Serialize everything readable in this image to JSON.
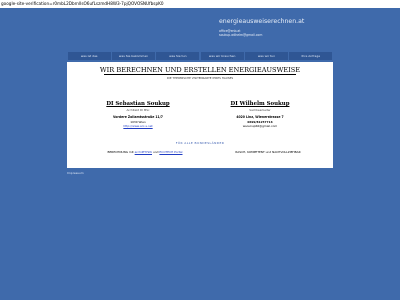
{
  "top_strip": {
    "text": "google-site-verification=r0mbL2DbrnlIsO6ufLszmdH8W3-7pjQOVOSNUfbspK0"
  },
  "banner": {
    "site_title": "energieausweiserechnen.at",
    "contact_line_1": "office@enb.at",
    "contact_line_2": "soukup.wilhelm@gmail.com"
  },
  "nav": {
    "items": [
      "was ist das",
      "was Sie bekommen",
      "was Sie tun",
      "was wir brauchen",
      "was wir tun",
      "Ihre Anfrage"
    ]
  },
  "main": {
    "title": "WIR BERECHNEN UND ERSTELLEN ENERGIEAUSWEISE",
    "subtitle": "DIE THERMISCHE VISITENKARTE IHRES HAUSES",
    "left_card": {
      "name": "DI Sebastian Soukup",
      "role": "Architekt DI MSc",
      "address": "Vordere Zollamtsstraße 11/7",
      "city": "1030 Wien",
      "link": "http://www.arc-s.net"
    },
    "right_card": {
      "name": "DI Wilhelm Soukup",
      "role": "Sachbearbeiter",
      "address": "4020 Linz, Wienerstrasse 7",
      "phone": "0699/81257716",
      "email": "wsoukup66@gmail.com"
    },
    "footer_caption": "FÜR ALLE BUNDESLÄNDER",
    "footer_left_prefix": "BERECHNUNG mit",
    "footer_left_link1": "archiPHYSIK",
    "footer_left_mid": "und",
    "footer_left_link2": "ECOTECH Portal",
    "footer_right": "RASCH, KOMPETENT und NACHVOLLZIEHBAR"
  },
  "impressum": {
    "label": "Impressum"
  },
  "colors": {
    "background": "#3f6aab",
    "nav": "#2f5694",
    "panel": "#ffffff",
    "link": "#1f3cc4"
  }
}
